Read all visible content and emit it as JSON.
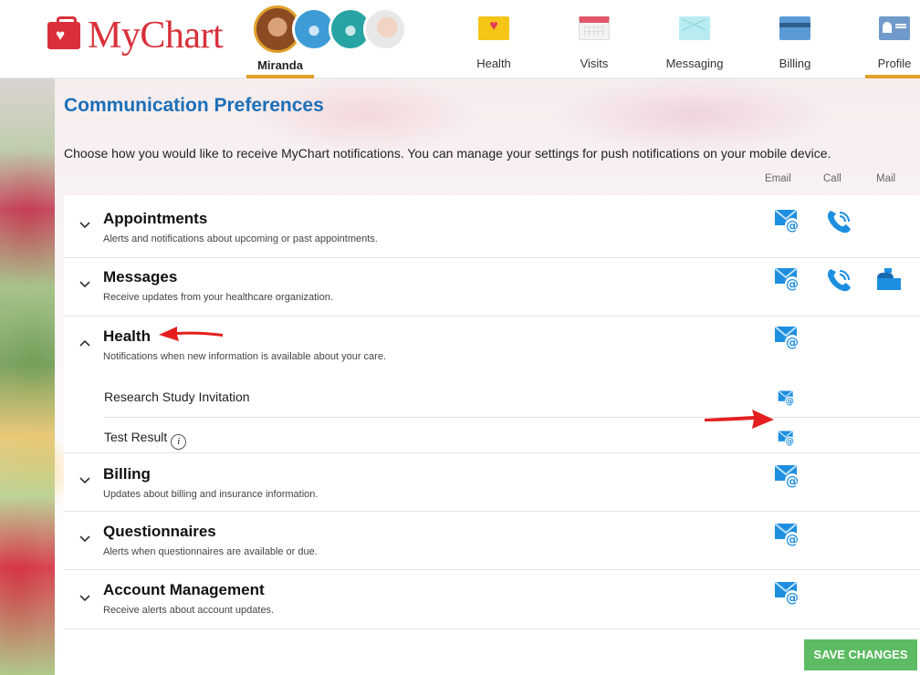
{
  "app": {
    "name": "MyChart"
  },
  "header": {
    "username": "Miranda",
    "nav": [
      {
        "label": "Health",
        "icon": "health-folder-icon"
      },
      {
        "label": "Visits",
        "icon": "calendar-icon"
      },
      {
        "label": "Messaging",
        "icon": "envelope-icon"
      },
      {
        "label": "Billing",
        "icon": "credit-card-icon"
      },
      {
        "label": "Profile",
        "icon": "id-card-icon"
      }
    ],
    "active_nav": "Profile"
  },
  "page": {
    "title": "Communication Preferences",
    "intro": "Choose how you would like to receive MyChart notifications. You can manage your settings for push notifications on your mobile device.",
    "columns": [
      "Email",
      "Call",
      "Mail"
    ]
  },
  "categories": [
    {
      "title": "Appointments",
      "desc": "Alerts and notifications about upcoming or past appointments.",
      "expanded": false,
      "channels": [
        "email",
        "call"
      ]
    },
    {
      "title": "Messages",
      "desc": "Receive updates from your healthcare organization.",
      "expanded": false,
      "channels": [
        "email",
        "call",
        "mail"
      ]
    },
    {
      "title": "Health",
      "desc": "Notifications when new information is available about your care.",
      "expanded": true,
      "channels": [
        "email"
      ],
      "items": [
        {
          "label": "Research Study Invitation",
          "channels": [
            "email"
          ]
        },
        {
          "label": "Test Result",
          "info_icon": "i",
          "channels": [
            "email"
          ]
        }
      ]
    },
    {
      "title": "Billing",
      "desc": "Updates about billing and insurance information.",
      "expanded": false,
      "channels": [
        "email"
      ]
    },
    {
      "title": "Questionnaires",
      "desc": "Alerts when questionnaires are available or due.",
      "expanded": false,
      "channels": [
        "email"
      ]
    },
    {
      "title": "Account Management",
      "desc": "Receive alerts about account updates.",
      "expanded": false,
      "channels": [
        "email"
      ]
    }
  ],
  "actions": {
    "save_label": "SAVE CHANGES"
  },
  "colors": {
    "brand": "#d9303a",
    "title_blue": "#1c6fb8",
    "icon_blue": "#1e8fe0",
    "save_green": "#5dbb63",
    "nav_accent": "#e0a02a",
    "annotation_red": "#e51f1f"
  }
}
